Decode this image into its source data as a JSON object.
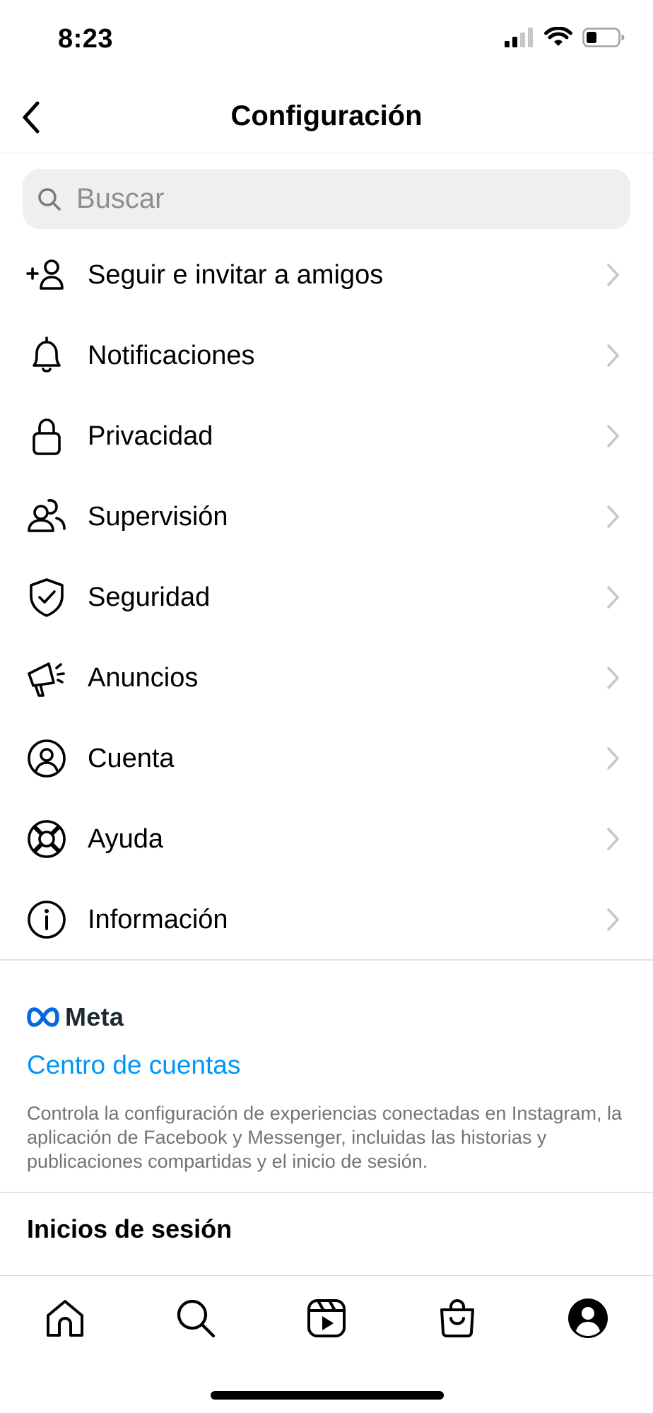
{
  "status": {
    "time": "8:23"
  },
  "header": {
    "title": "Configuración",
    "back_icon": "chevron-left-icon"
  },
  "search": {
    "placeholder": "Buscar",
    "value": ""
  },
  "menu": [
    {
      "label": "Seguir e invitar a amigos",
      "icon": "add-person-icon"
    },
    {
      "label": "Notificaciones",
      "icon": "bell-icon"
    },
    {
      "label": "Privacidad",
      "icon": "lock-icon"
    },
    {
      "label": "Supervisión",
      "icon": "people-icon"
    },
    {
      "label": "Seguridad",
      "icon": "shield-check-icon"
    },
    {
      "label": "Anuncios",
      "icon": "megaphone-icon"
    },
    {
      "label": "Cuenta",
      "icon": "account-circle-icon"
    },
    {
      "label": "Ayuda",
      "icon": "lifebuoy-icon"
    },
    {
      "label": "Información",
      "icon": "info-icon"
    }
  ],
  "meta": {
    "brand": "Meta",
    "link": "Centro de cuentas",
    "description": "Controla la configuración de experiencias conectadas en Instagram, la aplicación de Facebook y Messenger, incluidas las historias y publicaciones compartidas y el inicio de sesión."
  },
  "logins": {
    "title": "Inicios de sesión"
  },
  "tabbar": [
    "home-icon",
    "search-icon",
    "reels-icon",
    "shop-icon",
    "profile-icon"
  ],
  "colors": {
    "link": "#0095f6",
    "muted": "#737373",
    "meta_blue": "#0668e1"
  }
}
